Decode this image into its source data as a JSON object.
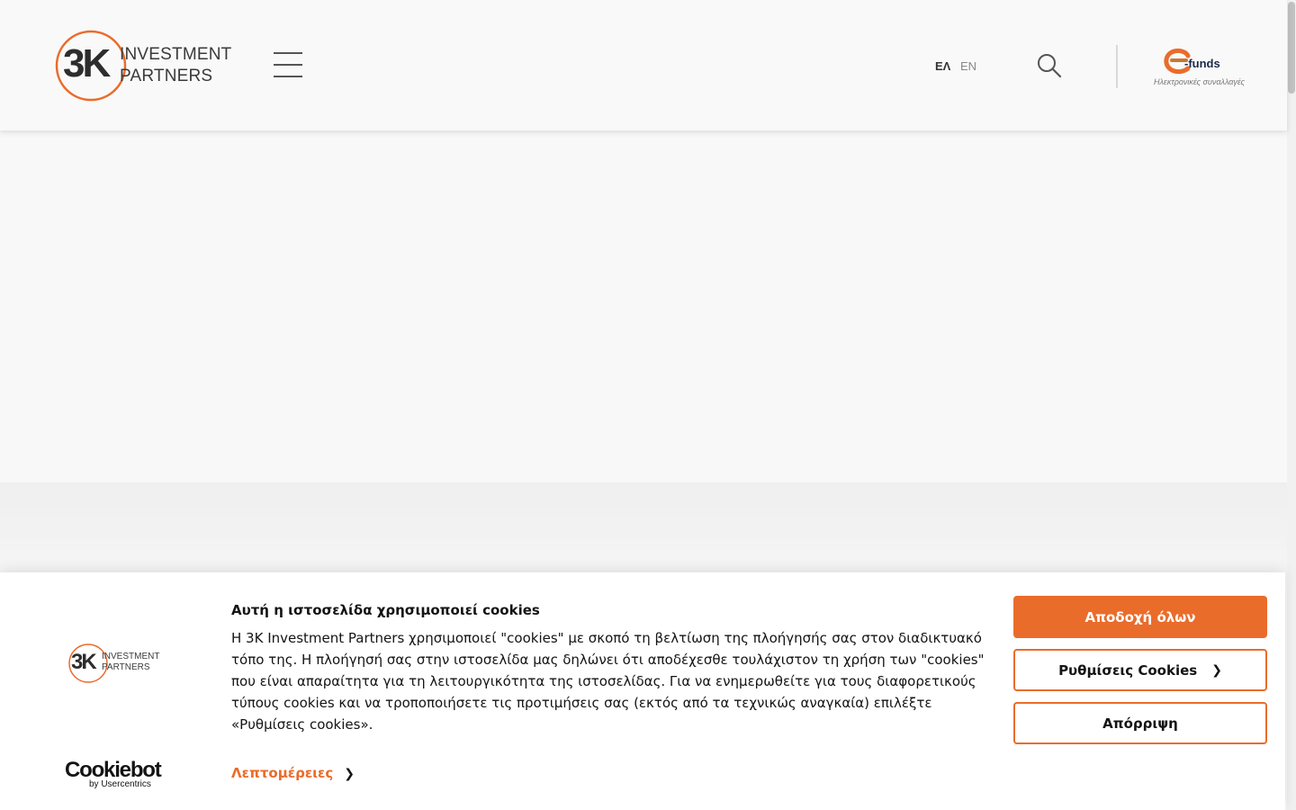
{
  "header": {
    "logo": {
      "mark": "3K",
      "line1": "INVESTMENT",
      "line2": "PARTNERS"
    },
    "languages": [
      {
        "label": "ΕΛ",
        "active": true
      },
      {
        "label": "EN",
        "active": false
      }
    ],
    "efunds": {
      "brand": "-funds",
      "subtitle": "Ηλεκτρονικές συναλλαγές"
    },
    "icons": {
      "menu": "hamburger-menu-icon",
      "search": "search-icon"
    }
  },
  "cookie_banner": {
    "logo": {
      "mark": "3K",
      "line1": "INVESTMENT",
      "line2": "PARTNERS"
    },
    "cookiebot": {
      "name": "Cookiebot",
      "by": "by Usercentrics"
    },
    "title": "Αυτή η ιστοσελίδα χρησιμοποιεί cookies",
    "body": "Η 3K Investment Partners χρησιμοποιεί \"cookies\" με σκοπό τη βελτίωση της πλοήγησής σας στον διαδικτυακό τόπο της. Η πλοήγησή σας στην ιστοσελίδα μας δηλώνει ότι αποδέχεσθε τουλάχιστον τη χρήση των \"cookies\" που είναι απαραίτητα για τη λειτουργικότητα της ιστοσελίδας. Για να ενημερωθείτε για τους διαφορετικούς τύπους cookies και να τροποποιήσετε τις προτιμήσεις σας (εκτός από τα τεχνικώς αναγκαία) επιλέξτε «Ρυθμίσεις cookies».",
    "details_label": "Λεπτομέρειες",
    "accept_label": "Αποδοχή όλων",
    "settings_label": "Ρυθμίσεις Cookies",
    "reject_label": "Απόρριψη"
  },
  "colors": {
    "accent": "#ea6c2b",
    "text": "#141414",
    "background": "#f9f9f9"
  }
}
